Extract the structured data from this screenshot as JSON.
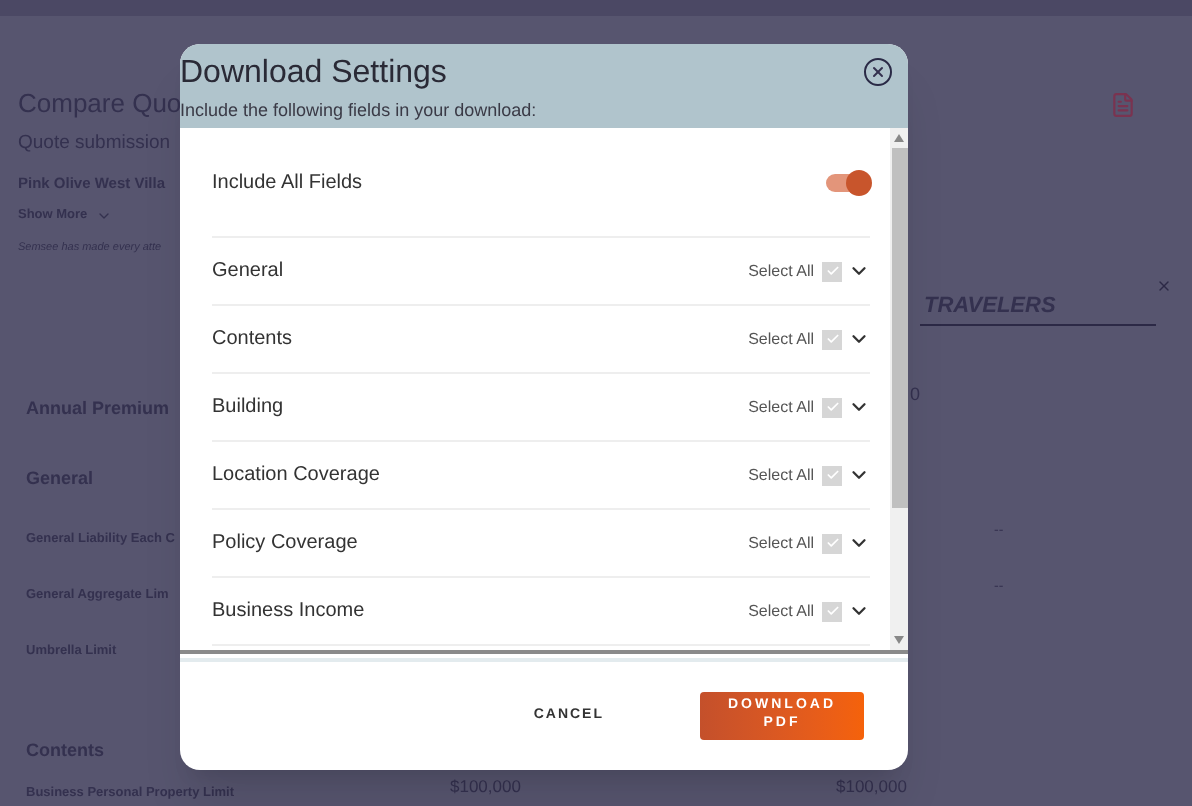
{
  "page": {
    "title": "Compare Quo",
    "subtitle": "Quote submission",
    "location": "Pink Olive West Villa",
    "show_more": "Show More",
    "disclaimer": "Semsee has made every atte",
    "carrier": "TRAVELERS",
    "premium_label": "Annual Premium",
    "premium_value": "0",
    "sections": [
      {
        "title": "General",
        "rows": [
          {
            "label": "General Liability Each C",
            "value": "--"
          },
          {
            "label": "General Aggregate Lim",
            "value": "--"
          },
          {
            "label": "Umbrella Limit",
            "value": ""
          }
        ]
      },
      {
        "title": "Contents",
        "rows": [
          {
            "label": "Business Personal Property Limit",
            "value": "$100,000",
            "value_2": "$100,000"
          }
        ]
      }
    ]
  },
  "dialog": {
    "title": "Download Settings",
    "subtitle": "Include the following fields in your download:",
    "include_all": {
      "label": "Include All Fields",
      "on": true
    },
    "groups": [
      {
        "label": "General",
        "select_label": "Select All",
        "checked": true
      },
      {
        "label": "Contents",
        "select_label": "Select All",
        "checked": true
      },
      {
        "label": "Building",
        "select_label": "Select All",
        "checked": true
      },
      {
        "label": "Location Coverage",
        "select_label": "Select All",
        "checked": true
      },
      {
        "label": "Policy Coverage",
        "select_label": "Select All",
        "checked": true
      },
      {
        "label": "Business Income",
        "select_label": "Select All",
        "checked": true
      }
    ],
    "buttons": {
      "cancel": "CANCEL",
      "download": "DOWNLOAD PDF"
    }
  }
}
